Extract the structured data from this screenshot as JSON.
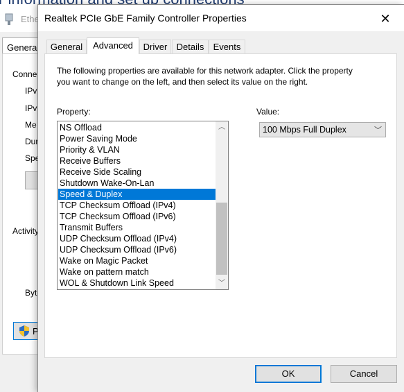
{
  "background_window": {
    "heading": "r information and set up connections",
    "title": "Ethe",
    "tab": "General",
    "labels": [
      "Conne",
      "IPv",
      "IPv",
      "Me",
      "Dur",
      "Spe",
      "Activity",
      "Byte"
    ],
    "properties_button_label": "P"
  },
  "dialog": {
    "title": "Realtek PCIe GbE Family Controller Properties",
    "close_glyph": "✕",
    "tabs": [
      "General",
      "Advanced",
      "Driver",
      "Details",
      "Events"
    ],
    "active_tab": "Advanced",
    "description": "The following properties are available for this network adapter. Click the property you want to change on the left, and then select its value on the right.",
    "property_label": "Property:",
    "value_label": "Value:",
    "properties": [
      "NS Offload",
      "Power Saving Mode",
      "Priority & VLAN",
      "Receive Buffers",
      "Receive Side Scaling",
      "Shutdown Wake-On-Lan",
      "Speed & Duplex",
      "TCP Checksum Offload (IPv4)",
      "TCP Checksum Offload (IPv6)",
      "Transmit Buffers",
      "UDP Checksum Offload (IPv4)",
      "UDP Checksum Offload (IPv6)",
      "Wake on Magic Packet",
      "Wake on pattern match",
      "WOL & Shutdown Link Speed"
    ],
    "selected_property": "Speed & Duplex",
    "selected_value": "100 Mbps Full Duplex",
    "ok_label": "OK",
    "cancel_label": "Cancel"
  },
  "colors": {
    "selection": "#0078d7",
    "dialog_bg": "#f0f0f0",
    "button_bg": "#e1e1e1"
  },
  "icons": {
    "scroll_up": "scroll-up-icon",
    "scroll_down": "scroll-down-icon",
    "dropdown": "chevron-down-icon",
    "shield": "uac-shield-icon"
  }
}
